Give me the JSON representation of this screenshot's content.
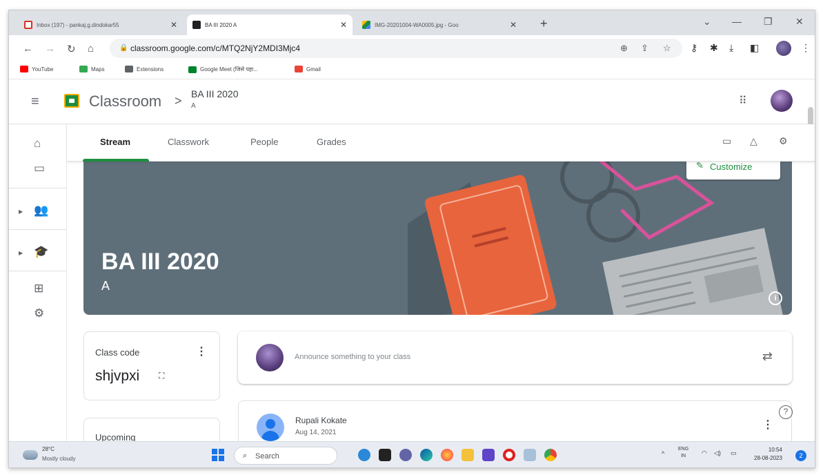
{
  "browser": {
    "tabs": [
      {
        "label": "Inbox (197) - pankaj.g.dindokar55",
        "favicon_color": "#d93025"
      },
      {
        "label": "BA III 2020 A",
        "favicon_color": "#202124"
      },
      {
        "label": "IMG-20201004-WA0005.jpg - Goo",
        "favicon_color": "#1e8e3e"
      }
    ],
    "close_glyph": "✕",
    "new_tab_glyph": "+",
    "url": "classroom.google.com/c/MTQ2NjY2MDI3Mjc4",
    "bookmarks": [
      {
        "label": "YouTube",
        "color": "#ff0000"
      },
      {
        "label": "Maps",
        "color": "#34a853"
      },
      {
        "label": "Extensions",
        "color": "#5f6368"
      },
      {
        "label": "Google Meet (जिसे पहा...",
        "color": "#00832d"
      },
      {
        "label": "Gmail",
        "color": "#ea4335"
      }
    ]
  },
  "classroom": {
    "app_title": "Classroom",
    "breadcrumb_sep": ">",
    "course_name": "BA III 2020",
    "course_section": "A",
    "tabs": [
      "Stream",
      "Classwork",
      "People",
      "Grades"
    ],
    "active_tab": "Stream",
    "banner_title": "BA III 2020",
    "banner_section": "A",
    "customize_label": "Customize",
    "class_code_label": "Class code",
    "class_code": "shjvpxi",
    "upcoming_label": "Upcoming",
    "announce_placeholder": "Announce something to your class",
    "post": {
      "author": "Rupali Kokate",
      "date": "Aug 14, 2021"
    },
    "accent_color": "#1e8e3e"
  },
  "taskbar": {
    "temperature": "28°C",
    "condition": "Mostly cloudy",
    "search_label": "Search",
    "lang": "ENG",
    "region": "IN",
    "time": "10:54",
    "date": "28-08-2023",
    "notification_count": "2"
  }
}
